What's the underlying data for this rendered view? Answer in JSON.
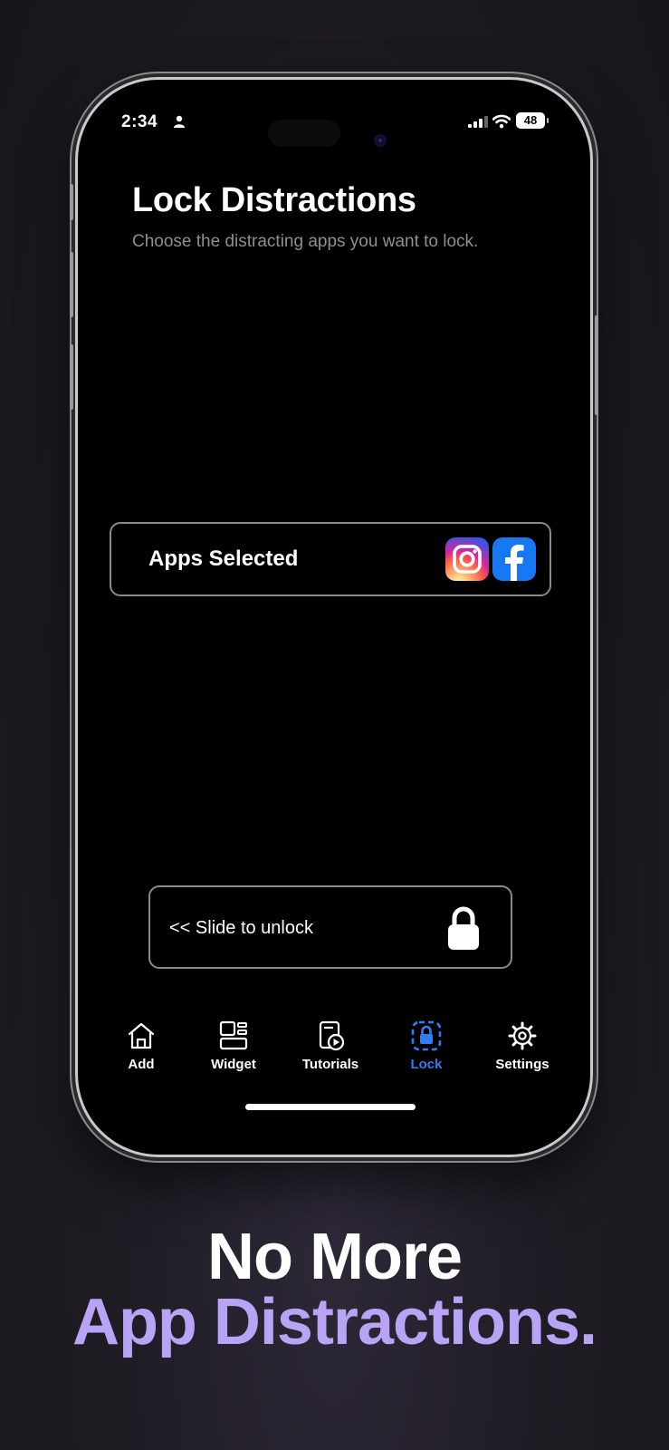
{
  "status_bar": {
    "time": "2:34",
    "battery": "48"
  },
  "screen": {
    "title": "Lock Distractions",
    "subtitle": "Choose the distracting apps you want to lock.",
    "apps_card": {
      "label": "Apps Selected",
      "apps": [
        "instagram-icon",
        "facebook-icon"
      ]
    },
    "slider": {
      "label": "<< Slide to unlock",
      "icon": "padlock-icon"
    }
  },
  "tabbar": {
    "active": "Lock",
    "active_color": "#2f7cf6",
    "items": [
      {
        "label": "Add",
        "icon": "house-icon"
      },
      {
        "label": "Widget",
        "icon": "widget-icon"
      },
      {
        "label": "Tutorials",
        "icon": "tutorials-icon"
      },
      {
        "label": "Lock",
        "icon": "lock-icon"
      },
      {
        "label": "Settings",
        "icon": "gear-icon"
      }
    ]
  },
  "promo": {
    "line1": "No More",
    "line2": "App Distractions.",
    "line2_color": "#b8a3f5"
  }
}
